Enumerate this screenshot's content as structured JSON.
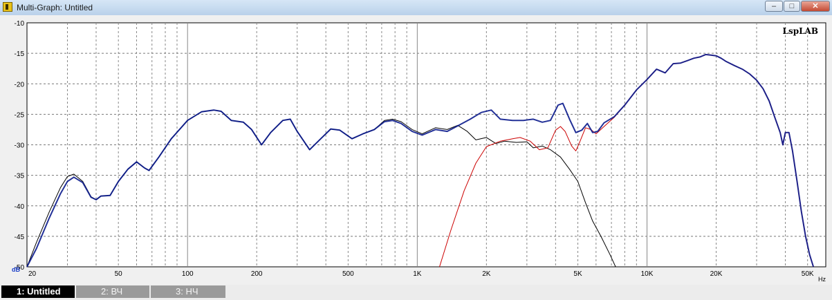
{
  "window": {
    "title": "Multi-Graph: Untitled",
    "minimize_label": "–",
    "maximize_label": "□",
    "close_label": "✕"
  },
  "tabs": [
    {
      "label": "1: Untitled",
      "active": true
    },
    {
      "label": "2: ВЧ",
      "active": false
    },
    {
      "label": "3: НЧ",
      "active": false
    }
  ],
  "chart_data": {
    "type": "line",
    "title": "",
    "watermark": "LspLAB",
    "xlabel": "Hz",
    "ylabel": "dB",
    "x_scale": "log",
    "xlim": [
      20,
      60000
    ],
    "ylim": [
      -50,
      -10
    ],
    "grid": true,
    "x_ticks": [
      {
        "value": 20,
        "label": "20"
      },
      {
        "value": 50,
        "label": "50"
      },
      {
        "value": 100,
        "label": "100"
      },
      {
        "value": 200,
        "label": "200"
      },
      {
        "value": 500,
        "label": "500"
      },
      {
        "value": 1000,
        "label": "1K"
      },
      {
        "value": 2000,
        "label": "2K"
      },
      {
        "value": 5000,
        "label": "5K"
      },
      {
        "value": 10000,
        "label": "10K"
      },
      {
        "value": 20000,
        "label": "20K"
      },
      {
        "value": 50000,
        "label": "50K"
      }
    ],
    "y_ticks": [
      -10,
      -15,
      -20,
      -25,
      -30,
      -35,
      -40,
      -45,
      -50
    ],
    "series": [
      {
        "color": "#000000",
        "points": [
          [
            20,
            -50
          ],
          [
            22,
            -46
          ],
          [
            25,
            -41
          ],
          [
            28,
            -37
          ],
          [
            30,
            -35.2
          ],
          [
            32,
            -34.8
          ],
          [
            35,
            -36
          ],
          [
            38,
            -38.5
          ],
          [
            40,
            -39
          ],
          [
            42,
            -38.4
          ],
          [
            46,
            -38.3
          ],
          [
            50,
            -36
          ],
          [
            55,
            -34
          ],
          [
            60,
            -32.8
          ],
          [
            65,
            -33.8
          ],
          [
            68,
            -34.2
          ],
          [
            75,
            -32
          ],
          [
            85,
            -29
          ],
          [
            100,
            -26
          ],
          [
            115,
            -24.6
          ],
          [
            130,
            -24.3
          ],
          [
            140,
            -24.5
          ],
          [
            155,
            -26
          ],
          [
            175,
            -26.3
          ],
          [
            190,
            -27.5
          ],
          [
            210,
            -30
          ],
          [
            230,
            -28
          ],
          [
            260,
            -26
          ],
          [
            280,
            -25.8
          ],
          [
            300,
            -27.8
          ],
          [
            340,
            -30.8
          ],
          [
            380,
            -29
          ],
          [
            420,
            -27.4
          ],
          [
            460,
            -27.6
          ],
          [
            520,
            -29
          ],
          [
            580,
            -28.2
          ],
          [
            650,
            -27.5
          ],
          [
            720,
            -26
          ],
          [
            780,
            -25.8
          ],
          [
            850,
            -26.2
          ],
          [
            950,
            -27.5
          ],
          [
            1050,
            -28.2
          ],
          [
            1200,
            -27.2
          ],
          [
            1350,
            -27.5
          ],
          [
            1500,
            -26.8
          ],
          [
            1650,
            -27.8
          ],
          [
            1800,
            -29.2
          ],
          [
            2000,
            -28.8
          ],
          [
            2200,
            -29.8
          ],
          [
            2400,
            -29.4
          ],
          [
            2700,
            -29.6
          ],
          [
            3000,
            -29.5
          ],
          [
            3200,
            -30.5
          ],
          [
            3500,
            -30.2
          ],
          [
            3800,
            -30.8
          ],
          [
            4200,
            -32
          ],
          [
            4600,
            -34
          ],
          [
            5000,
            -36
          ],
          [
            5400,
            -39.5
          ],
          [
            5800,
            -42.5
          ],
          [
            6300,
            -45
          ],
          [
            6900,
            -48
          ],
          [
            7300,
            -50
          ]
        ]
      },
      {
        "color": "#cc0000",
        "points": [
          [
            1250,
            -50
          ],
          [
            1400,
            -44
          ],
          [
            1600,
            -37.5
          ],
          [
            1800,
            -33
          ],
          [
            2000,
            -30.3
          ],
          [
            2300,
            -29.4
          ],
          [
            2600,
            -29
          ],
          [
            2800,
            -28.8
          ],
          [
            3100,
            -29.4
          ],
          [
            3400,
            -30.8
          ],
          [
            3700,
            -30.5
          ],
          [
            4000,
            -27.6
          ],
          [
            4200,
            -27
          ],
          [
            4400,
            -27.8
          ],
          [
            4700,
            -30.2
          ],
          [
            4900,
            -31
          ],
          [
            5100,
            -29.5
          ],
          [
            5400,
            -27.2
          ],
          [
            5700,
            -27.5
          ],
          [
            6000,
            -28.2
          ],
          [
            6500,
            -27
          ],
          [
            7200,
            -25.5
          ],
          [
            8000,
            -23.5
          ],
          [
            9000,
            -21
          ],
          [
            10000,
            -19.3
          ],
          [
            11000,
            -17.6
          ],
          [
            12000,
            -18.2
          ],
          [
            13000,
            -16.7
          ],
          [
            14000,
            -16.6
          ],
          [
            15000,
            -16.2
          ],
          [
            16000,
            -15.8
          ],
          [
            17000,
            -15.6
          ],
          [
            18000,
            -15.2
          ],
          [
            19000,
            -15.3
          ],
          [
            20000,
            -15.4
          ],
          [
            21000,
            -15.8
          ],
          [
            22000,
            -16.3
          ],
          [
            24000,
            -17
          ],
          [
            26000,
            -17.6
          ],
          [
            28000,
            -18.4
          ],
          [
            30000,
            -19.4
          ],
          [
            32000,
            -20.8
          ],
          [
            34000,
            -22.8
          ],
          [
            36000,
            -25.5
          ],
          [
            38000,
            -28
          ],
          [
            39000,
            -30
          ],
          [
            40000,
            -28
          ],
          [
            41500,
            -28
          ],
          [
            43000,
            -31
          ],
          [
            45000,
            -36
          ],
          [
            47000,
            -41
          ],
          [
            49000,
            -45
          ],
          [
            51000,
            -48
          ],
          [
            53000,
            -50
          ]
        ]
      },
      {
        "color": "#0a1a8c",
        "points": [
          [
            20,
            -50
          ],
          [
            22,
            -47
          ],
          [
            25,
            -42
          ],
          [
            28,
            -38
          ],
          [
            30,
            -36
          ],
          [
            32,
            -35.3
          ],
          [
            35,
            -36.2
          ],
          [
            38,
            -38.6
          ],
          [
            40,
            -39
          ],
          [
            42,
            -38.4
          ],
          [
            46,
            -38.3
          ],
          [
            50,
            -36
          ],
          [
            55,
            -34
          ],
          [
            60,
            -32.8
          ],
          [
            65,
            -33.8
          ],
          [
            68,
            -34.2
          ],
          [
            75,
            -32
          ],
          [
            85,
            -29
          ],
          [
            100,
            -26
          ],
          [
            115,
            -24.6
          ],
          [
            130,
            -24.3
          ],
          [
            140,
            -24.5
          ],
          [
            155,
            -26
          ],
          [
            175,
            -26.3
          ],
          [
            190,
            -27.5
          ],
          [
            210,
            -30
          ],
          [
            230,
            -28
          ],
          [
            260,
            -26
          ],
          [
            280,
            -25.8
          ],
          [
            300,
            -27.8
          ],
          [
            340,
            -30.8
          ],
          [
            380,
            -29
          ],
          [
            420,
            -27.4
          ],
          [
            460,
            -27.6
          ],
          [
            520,
            -29
          ],
          [
            580,
            -28.2
          ],
          [
            650,
            -27.5
          ],
          [
            720,
            -26.2
          ],
          [
            780,
            -26
          ],
          [
            850,
            -26.5
          ],
          [
            950,
            -27.8
          ],
          [
            1050,
            -28.4
          ],
          [
            1200,
            -27.5
          ],
          [
            1350,
            -27.8
          ],
          [
            1500,
            -26.9
          ],
          [
            1700,
            -25.8
          ],
          [
            1900,
            -24.7
          ],
          [
            2100,
            -24.3
          ],
          [
            2300,
            -25.8
          ],
          [
            2600,
            -26
          ],
          [
            2900,
            -26
          ],
          [
            3200,
            -25.8
          ],
          [
            3500,
            -26.3
          ],
          [
            3800,
            -26
          ],
          [
            4100,
            -23.5
          ],
          [
            4300,
            -23.2
          ],
          [
            4600,
            -25.8
          ],
          [
            4900,
            -28
          ],
          [
            5200,
            -27.6
          ],
          [
            5500,
            -26.5
          ],
          [
            5800,
            -28
          ],
          [
            6100,
            -27.8
          ],
          [
            6500,
            -26.4
          ],
          [
            7200,
            -25.4
          ],
          [
            8000,
            -23.5
          ],
          [
            9000,
            -21
          ],
          [
            10000,
            -19.3
          ],
          [
            11000,
            -17.6
          ],
          [
            12000,
            -18.2
          ],
          [
            13000,
            -16.7
          ],
          [
            14000,
            -16.6
          ],
          [
            15000,
            -16.2
          ],
          [
            16000,
            -15.8
          ],
          [
            17000,
            -15.6
          ],
          [
            18000,
            -15.2
          ],
          [
            19000,
            -15.3
          ],
          [
            20000,
            -15.4
          ],
          [
            21000,
            -15.8
          ],
          [
            22000,
            -16.3
          ],
          [
            24000,
            -17
          ],
          [
            26000,
            -17.6
          ],
          [
            28000,
            -18.4
          ],
          [
            30000,
            -19.4
          ],
          [
            32000,
            -20.8
          ],
          [
            34000,
            -22.8
          ],
          [
            36000,
            -25.5
          ],
          [
            38000,
            -28
          ],
          [
            39000,
            -30
          ],
          [
            40000,
            -28
          ],
          [
            41500,
            -28
          ],
          [
            43000,
            -31
          ],
          [
            45000,
            -36
          ],
          [
            47000,
            -41
          ],
          [
            49000,
            -45
          ],
          [
            51000,
            -48
          ],
          [
            53000,
            -50
          ]
        ]
      }
    ]
  }
}
